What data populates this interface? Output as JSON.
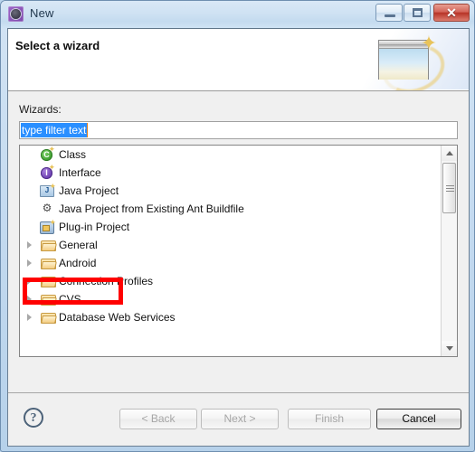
{
  "window": {
    "title": "New",
    "icon": "eclipse-new-wizard-icon",
    "controls": {
      "minimize": "minimize-icon",
      "maximize": "maximize-icon",
      "close": "✕"
    }
  },
  "banner": {
    "title": "Select a wizard",
    "art_icon": "wizard-window-sparkle-icon"
  },
  "form": {
    "wizards_label": "Wizards:",
    "filter": {
      "value": "type filter text",
      "placeholder": "type filter text",
      "selected": true
    }
  },
  "tree": {
    "items": [
      {
        "label": "Class",
        "icon": "class-icon",
        "expandable": false
      },
      {
        "label": "Interface",
        "icon": "interface-icon",
        "expandable": false
      },
      {
        "label": "Java Project",
        "icon": "java-project-icon",
        "expandable": false
      },
      {
        "label": "Java Project from Existing Ant Buildfile",
        "icon": "ant-buildfile-icon",
        "expandable": false
      },
      {
        "label": "Plug-in Project",
        "icon": "plugin-project-icon",
        "expandable": false
      },
      {
        "label": "General",
        "icon": "folder-icon",
        "expandable": true
      },
      {
        "label": "Android",
        "icon": "folder-icon",
        "expandable": true
      },
      {
        "label": "Connection Profiles",
        "icon": "folder-icon",
        "expandable": true
      },
      {
        "label": "CVS",
        "icon": "folder-icon",
        "expandable": true
      },
      {
        "label": "Database Web Services",
        "icon": "folder-icon",
        "expandable": true
      }
    ],
    "highlight": {
      "target_label": "Android",
      "color": "#ff0000"
    },
    "scrollbar": {
      "up_arrow": "scroll-up-icon",
      "down_arrow": "scroll-down-icon"
    }
  },
  "footer": {
    "help": "?",
    "buttons": [
      {
        "label": "< Back",
        "enabled": false
      },
      {
        "label": "Next >",
        "enabled": false
      },
      {
        "label": "Finish",
        "enabled": false
      },
      {
        "label": "Cancel",
        "enabled": true
      }
    ]
  }
}
